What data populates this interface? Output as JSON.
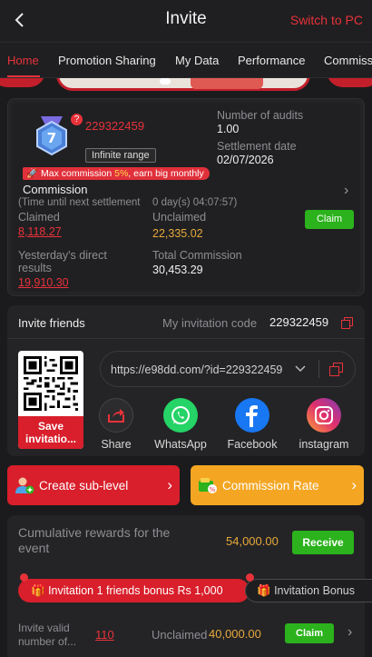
{
  "header": {
    "title": "Invite",
    "switch_label": "Switch to PC"
  },
  "tabs": [
    {
      "label": "Home",
      "active": true
    },
    {
      "label": "Promotion Sharing",
      "active": false
    },
    {
      "label": "My Data",
      "active": false
    },
    {
      "label": "Performance",
      "active": false
    },
    {
      "label": "Commiss",
      "active": false
    }
  ],
  "commission_card": {
    "level": "7",
    "user_id": "229322459",
    "range_badge": "Infinite range",
    "audits_label": "Number of audits",
    "audits_value": "1.00",
    "settlement_label": "Settlement date",
    "settlement_value": "02/07/2026",
    "promo_prefix": "Max commission ",
    "promo_pct": "5%",
    "promo_suffix": ", earn big monthly",
    "title": "Commission",
    "time_label": "(Time until next settlement",
    "time_value": "0 day(s) 04:07:57)",
    "claimed_label": "Claimed",
    "claimed_value": "8,118.27",
    "unclaimed_label": "Unclaimed",
    "unclaimed_value": "22,335.02",
    "claim_button": "Claim",
    "yesterday_label": "Yesterday's direct results",
    "yesterday_value": "19,910.30",
    "total_label": "Total Commission",
    "total_value": "30,453.29"
  },
  "invite_card": {
    "title": "Invite friends",
    "code_label": "My invitation code",
    "code_value": "229322459",
    "save_label": "Save invitatio...",
    "link": "https://e98dd.com/?id=229322459",
    "share_items": [
      {
        "label": "Share",
        "icon": "share-icon"
      },
      {
        "label": "WhatsApp",
        "icon": "whatsapp-icon"
      },
      {
        "label": "Facebook",
        "icon": "facebook-icon"
      },
      {
        "label": "instagram",
        "icon": "instagram-icon"
      }
    ]
  },
  "actions": {
    "create_sublevel": "Create sub-level",
    "commission_rate": "Commission Rate"
  },
  "rewards_card": {
    "title": "Cumulative rewards for the event",
    "amount": "54,000.00",
    "receive_button": "Receive",
    "bonus_active": "Invitation 1 friends bonus Rs 1,000",
    "bonus_other": "Invitation Bonus",
    "valid_label": "Invite valid number of...",
    "valid_value": "110",
    "unclaimed_label": "Unclaimed",
    "unclaimed_value": "40,000.00",
    "claim_button": "Claim"
  },
  "colors": {
    "accent_red": "#e8323a",
    "green": "#2bb21c",
    "orange": "#f4a623",
    "bg": "#1b1b1d"
  }
}
